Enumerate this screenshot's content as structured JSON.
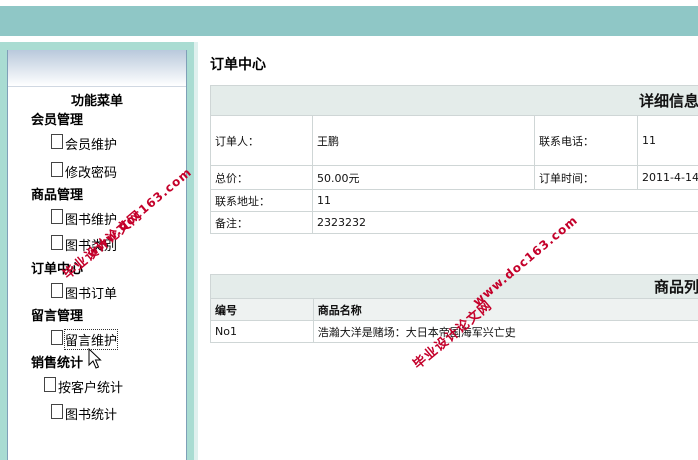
{
  "sidebar": {
    "title": "功能菜单",
    "groups": [
      {
        "label": "会员管理",
        "items": [
          "会员维护",
          "修改密码"
        ]
      },
      {
        "label": "商品管理",
        "items": [
          "图书维护",
          "图书类别"
        ]
      },
      {
        "label": "订单中心",
        "items": [
          "图书订单"
        ]
      },
      {
        "label": "留言管理",
        "items": [
          "留言维护"
        ]
      },
      {
        "label": "销售统计",
        "items": [
          "按客户统计",
          "图书统计"
        ]
      }
    ]
  },
  "main": {
    "title": "订单中心",
    "detail": {
      "header": "详细信息",
      "orderer_label": "订单人：",
      "orderer": "王鹏",
      "phone_label": "联系电话：",
      "phone": "11",
      "total_label": "总价：",
      "total": "50.00元",
      "time_label": "订单时间：",
      "time": "2011-4-14",
      "address_label": "联系地址：",
      "address": "11",
      "remark_label": "备注：",
      "remark": "2323232"
    },
    "products": {
      "header": "商品列",
      "columns": [
        "编号",
        "商品名称"
      ],
      "rows": [
        [
          "No1",
          "浩瀚大洋是赌场：大日本帝国海军兴亡史"
        ]
      ]
    }
  },
  "watermarks": {
    "line1": "毕业设计论文网",
    "line2": "www.doc163.com"
  },
  "colors": {
    "top_band": "#8fc7c6",
    "sidebar_bg": "#a9dcd2",
    "watermark": "#c4002a"
  }
}
